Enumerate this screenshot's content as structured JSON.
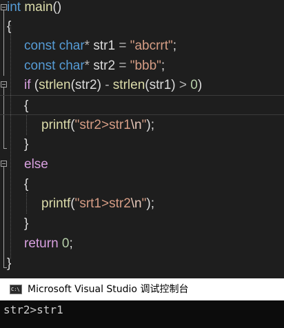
{
  "editor": {
    "lines": [
      {
        "tokens": [
          {
            "c": "kw",
            "t": "int"
          },
          {
            "c": "id",
            "t": " "
          },
          {
            "c": "fn",
            "t": "main"
          },
          {
            "c": "id",
            "t": "()"
          }
        ]
      },
      {
        "tokens": [
          {
            "c": "id",
            "t": "{"
          }
        ]
      },
      {
        "tokens": [
          {
            "c": "kw",
            "t": "const"
          },
          {
            "c": "id",
            "t": " "
          },
          {
            "c": "kw",
            "t": "char"
          },
          {
            "c": "op",
            "t": "*"
          },
          {
            "c": "id",
            "t": " str1 "
          },
          {
            "c": "op",
            "t": "="
          },
          {
            "c": "id",
            "t": " "
          },
          {
            "c": "str",
            "t": "\"abcrrt\""
          },
          {
            "c": "id",
            "t": ";"
          }
        ]
      },
      {
        "tokens": [
          {
            "c": "kw",
            "t": "const"
          },
          {
            "c": "id",
            "t": " "
          },
          {
            "c": "kw",
            "t": "char"
          },
          {
            "c": "op",
            "t": "*"
          },
          {
            "c": "id",
            "t": " str2 "
          },
          {
            "c": "op",
            "t": "="
          },
          {
            "c": "id",
            "t": " "
          },
          {
            "c": "str",
            "t": "\"bbb\""
          },
          {
            "c": "id",
            "t": ";"
          }
        ]
      },
      {
        "tokens": [
          {
            "c": "ctrl",
            "t": "if"
          },
          {
            "c": "id",
            "t": " ("
          },
          {
            "c": "fn",
            "t": "strlen"
          },
          {
            "c": "id",
            "t": "(str2) "
          },
          {
            "c": "op",
            "t": "-"
          },
          {
            "c": "id",
            "t": " "
          },
          {
            "c": "fn",
            "t": "strlen"
          },
          {
            "c": "id",
            "t": "(str1) "
          },
          {
            "c": "op",
            "t": ">"
          },
          {
            "c": "id",
            "t": " "
          },
          {
            "c": "num",
            "t": "0"
          },
          {
            "c": "id",
            "t": ")"
          }
        ]
      },
      {
        "tokens": [
          {
            "c": "id",
            "t": "{"
          }
        ]
      },
      {
        "tokens": [
          {
            "c": "fn",
            "t": "printf"
          },
          {
            "c": "id",
            "t": "("
          },
          {
            "c": "str",
            "t": "\"str2>str1"
          },
          {
            "c": "esc",
            "t": "\\n"
          },
          {
            "c": "str",
            "t": "\""
          },
          {
            "c": "id",
            "t": ");"
          }
        ]
      },
      {
        "tokens": [
          {
            "c": "id",
            "t": "}"
          }
        ]
      },
      {
        "tokens": [
          {
            "c": "ctrl",
            "t": "else"
          }
        ]
      },
      {
        "tokens": [
          {
            "c": "id",
            "t": "{"
          }
        ]
      },
      {
        "tokens": [
          {
            "c": "fn",
            "t": "printf"
          },
          {
            "c": "id",
            "t": "("
          },
          {
            "c": "str",
            "t": "\"srt1>str2"
          },
          {
            "c": "esc",
            "t": "\\n"
          },
          {
            "c": "str",
            "t": "\""
          },
          {
            "c": "id",
            "t": ");"
          }
        ]
      },
      {
        "tokens": [
          {
            "c": "id",
            "t": "}"
          }
        ]
      },
      {
        "tokens": [
          {
            "c": "ctrl",
            "t": "return"
          },
          {
            "c": "id",
            "t": " "
          },
          {
            "c": "num",
            "t": "0"
          },
          {
            "c": "id",
            "t": ";"
          }
        ]
      },
      {
        "tokens": [
          {
            "c": "id",
            "t": "}"
          }
        ]
      }
    ]
  },
  "console": {
    "icon_text": "C:\\",
    "title": "Microsoft Visual Studio 调试控制台",
    "output": "str2>str1"
  },
  "colors": {
    "background": "#1e1e1e",
    "keyword": "#569cd6",
    "control": "#d8a0df",
    "function": "#dcdcaa",
    "string": "#d69d85",
    "number": "#b5cea8",
    "text": "#dcdcdc"
  }
}
